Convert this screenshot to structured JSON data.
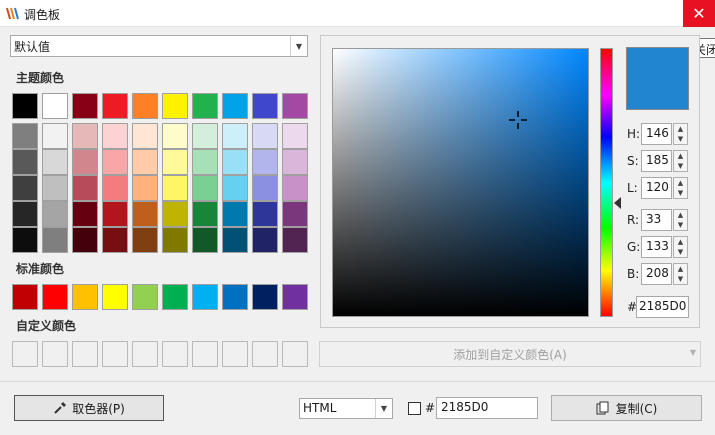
{
  "window": {
    "title": "调色板",
    "close_tooltip": "关闭"
  },
  "preset": {
    "value": "默认值"
  },
  "labels": {
    "theme": "主题颜色",
    "standard": "标准颜色",
    "custom": "自定义颜色"
  },
  "theme_base": [
    "#000000",
    "#ffffff",
    "#880015",
    "#ed1c24",
    "#ff7f27",
    "#fff200",
    "#22b14c",
    "#00a2e8",
    "#3f48cc",
    "#a349a4"
  ],
  "theme_shades": [
    [
      "#7f7f7f",
      "#595959",
      "#3f3f3f",
      "#262626",
      "#0d0d0d"
    ],
    [
      "#f2f2f2",
      "#d8d8d8",
      "#bfbfbf",
      "#a5a5a5",
      "#7f7f7f"
    ],
    [
      "#e6b8b7",
      "#d0868c",
      "#b84b5a",
      "#660010",
      "#44000b"
    ],
    [
      "#fbd3d3",
      "#f8a7a9",
      "#f47b7e",
      "#b2151b",
      "#760e12"
    ],
    [
      "#ffe5d4",
      "#ffcba9",
      "#ffb27d",
      "#bf5f1d",
      "#7f3f13"
    ],
    [
      "#fffccc",
      "#fff999",
      "#fff666",
      "#bfb500",
      "#7f7900"
    ],
    [
      "#d3efdb",
      "#a7e0b7",
      "#7ad093",
      "#198539",
      "#115926"
    ],
    [
      "#cceffa",
      "#99e0f6",
      "#66d0f1",
      "#0079ae",
      "#005174"
    ],
    [
      "#d8daf5",
      "#b2b5eb",
      "#8b91e0",
      "#2f3699",
      "#202466"
    ],
    [
      "#edd9ed",
      "#dab6db",
      "#c892c8",
      "#7a377b",
      "#522452"
    ]
  ],
  "standard_colors": [
    "#c00000",
    "#ff0000",
    "#ffc000",
    "#ffff00",
    "#92d050",
    "#00b050",
    "#00b0f0",
    "#0070c0",
    "#002060",
    "#7030a0"
  ],
  "add_custom_label": "添加到自定义颜色(A)",
  "current_color": "#2185D0",
  "hsl": {
    "h_label": "H:",
    "h": "146",
    "s_label": "S:",
    "s": "185",
    "l_label": "L:",
    "l": "120"
  },
  "rgb": {
    "r_label": "R:",
    "r": "33",
    "g_label": "G:",
    "g": "133",
    "b_label": "B:",
    "b": "208"
  },
  "hex": {
    "label": "#",
    "value": "2185D0"
  },
  "footer": {
    "eyedropper_label": "取色器(P)",
    "format_value": "HTML",
    "hash": "#",
    "hex_value": "2185D0",
    "copy_label": "复制(C)"
  }
}
